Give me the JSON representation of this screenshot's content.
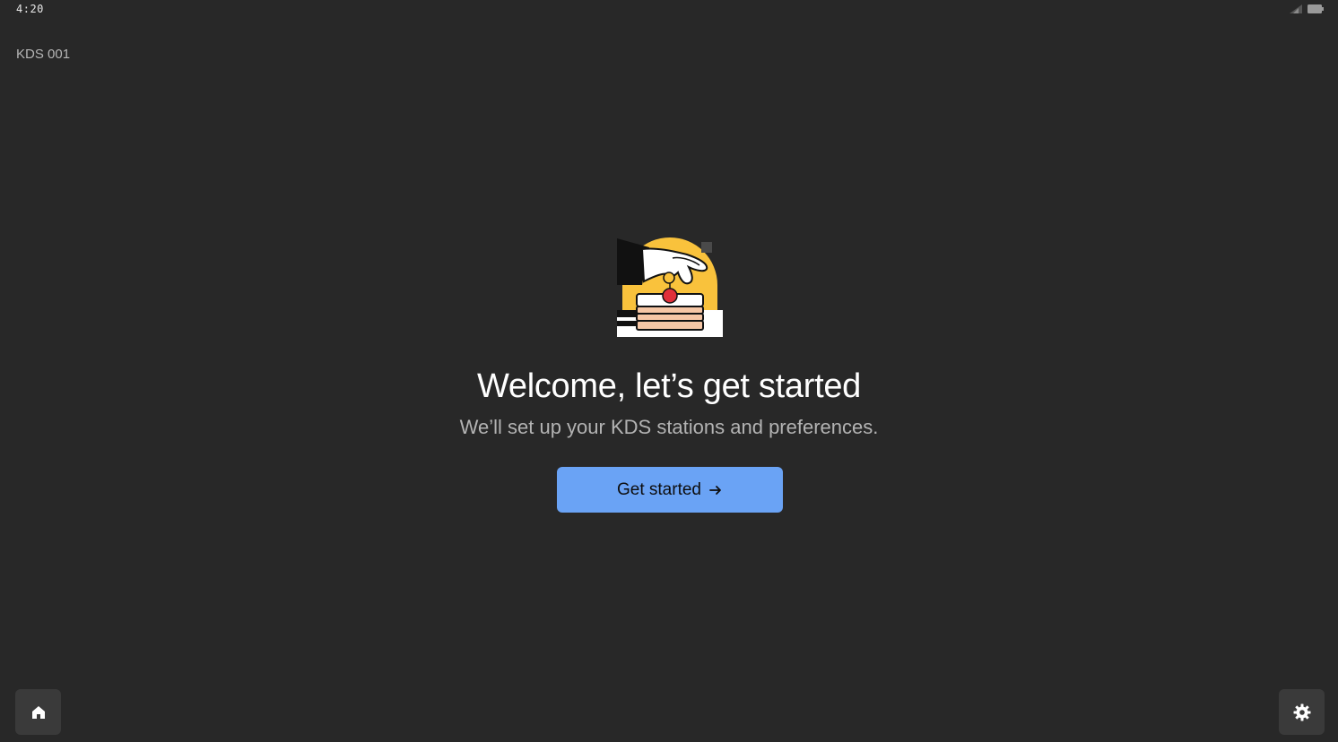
{
  "status_bar": {
    "time": "4:20",
    "icons": [
      "signal-icon",
      "battery-icon"
    ]
  },
  "header": {
    "device_name": "KDS 001"
  },
  "welcome": {
    "illustration": "chef-hand-cake-illustration",
    "title": "Welcome, let’s get started",
    "subtitle": "We’ll set up your KDS stations and preferences.",
    "cta_label": "Get started",
    "cta_icon": "arrow-right-icon"
  },
  "footer": {
    "home_icon": "home-icon",
    "settings_icon": "gear-icon"
  },
  "colors": {
    "background": "#282828",
    "accent": "#6aa3f5",
    "corner_button": "#3a3a3a",
    "illustration_yellow": "#f9c23c"
  }
}
